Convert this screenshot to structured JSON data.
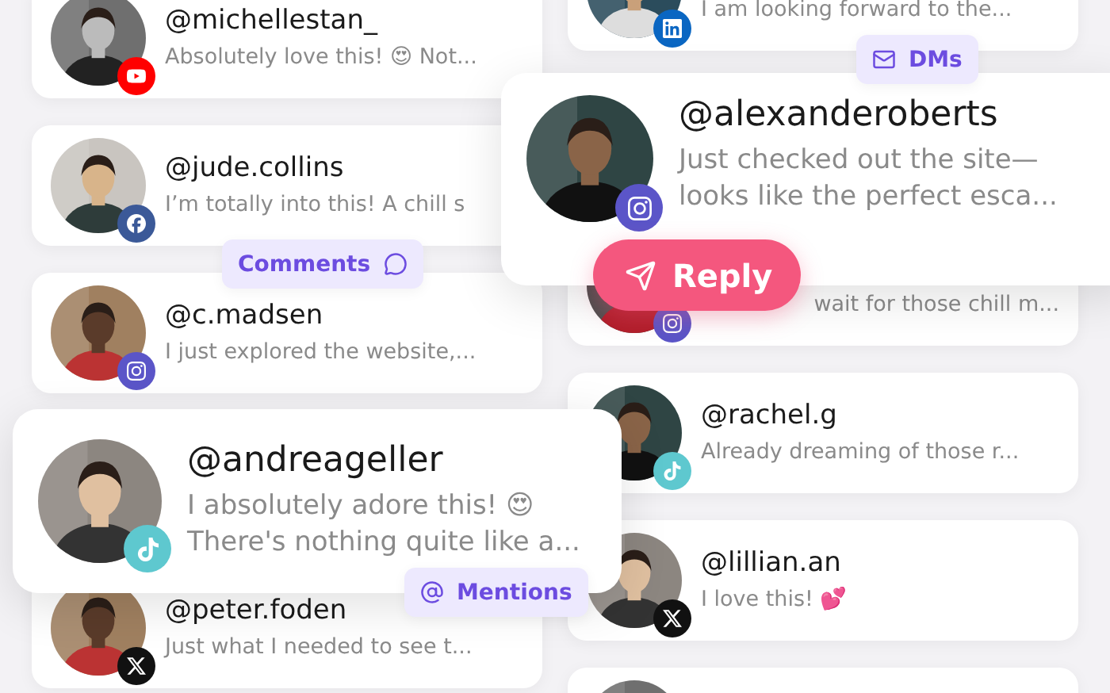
{
  "left_column": {
    "upper": [
      {
        "name": "@michellestan_",
        "message": "Absolutely love this! 😍 Not...",
        "kind": "youtube"
      },
      {
        "name": "@jude.collins",
        "message": "I’m totally into this! A chill s",
        "kind": "facebook"
      },
      {
        "name": "@c.madsen",
        "message": "I just explored the website,...",
        "kind": "instagram"
      }
    ],
    "lower": [
      {
        "name": "@peter.foden",
        "message": "Just what I needed to see t...",
        "kind": "x"
      }
    ]
  },
  "right_column": {
    "upper": [
      {
        "message": "I am looking forward to the...",
        "kind": "linkedin"
      }
    ],
    "lower": [
      {
        "message": "wait for those chill m...",
        "kind": "instagram",
        "partly_covered": true
      },
      {
        "name": "@rachel.g",
        "message": "Already dreaming of those r...",
        "kind": "tiktok"
      },
      {
        "name": "@lillian.an",
        "message": "I love this! 💕",
        "kind": "x"
      },
      {
        "kind": "plain"
      }
    ]
  },
  "featured": {
    "upper": {
      "name": "@alexanderoberts",
      "message": [
        "Just checked out the site—",
        "looks like the perfect esca..."
      ],
      "kind": "instagram"
    },
    "lower": {
      "name": "@andreageller",
      "message": [
        "I absolutely adore this! 😍",
        "There's nothing quite like a..."
      ],
      "kind": "tiktok"
    }
  },
  "tags": [
    {
      "kind": "comments",
      "label": "Comments"
    },
    {
      "kind": "dms",
      "label": "DMs"
    },
    {
      "kind": "mentions",
      "label": "Mentions"
    }
  ],
  "reply_button": {
    "label": "Reply"
  }
}
